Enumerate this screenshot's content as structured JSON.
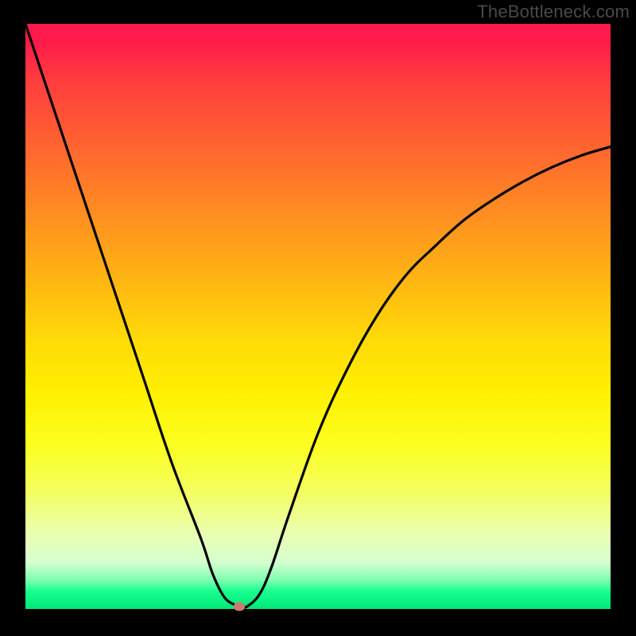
{
  "watermark": "TheBottleneck.com",
  "chart_data": {
    "type": "line",
    "title": "",
    "xlabel": "",
    "ylabel": "",
    "xlim": [
      0,
      100
    ],
    "ylim": [
      0,
      100
    ],
    "grid": false,
    "legend": false,
    "series": [
      {
        "name": "bottleneck-curve",
        "x": [
          0,
          5,
          10,
          15,
          20,
          25,
          30,
          32,
          34,
          36,
          37,
          38,
          40,
          42,
          45,
          50,
          55,
          60,
          65,
          70,
          75,
          80,
          85,
          90,
          95,
          100
        ],
        "y": [
          100,
          85,
          70,
          55,
          40,
          25,
          12,
          6,
          2,
          0.6,
          0.3,
          0.5,
          2.5,
          7,
          16,
          30,
          41,
          50,
          57,
          62,
          66.5,
          70,
          73,
          75.5,
          77.5,
          79
        ]
      }
    ],
    "marker": {
      "x": 36.5,
      "y": 0.4
    },
    "background": {
      "type": "vertical-gradient",
      "stops": [
        {
          "pos": 0,
          "color": "#ff1a4b"
        },
        {
          "pos": 50,
          "color": "#ffcc00"
        },
        {
          "pos": 85,
          "color": "#f6ff80"
        },
        {
          "pos": 100,
          "color": "#00e878"
        }
      ]
    }
  }
}
